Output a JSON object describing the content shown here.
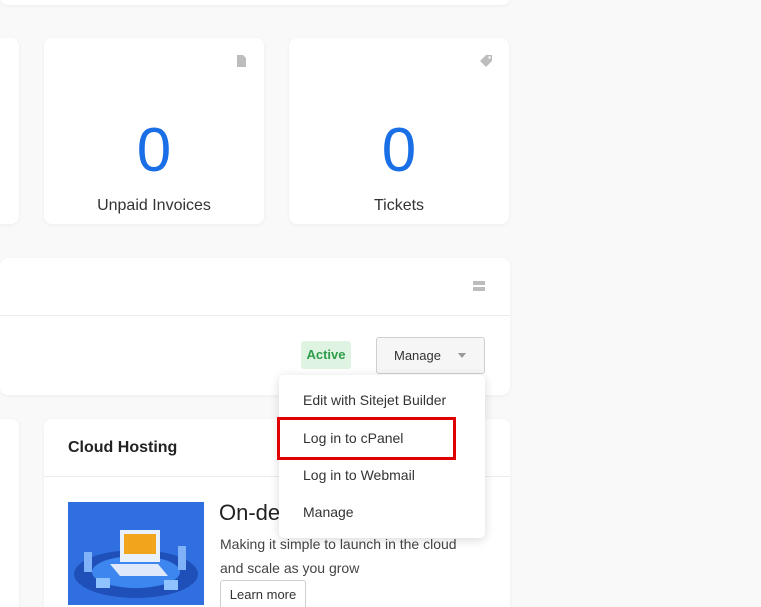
{
  "stats": {
    "invoices": {
      "value": "0",
      "label": "Unpaid Invoices",
      "icon": "document-icon"
    },
    "tickets": {
      "value": "0",
      "label": "Tickets",
      "icon": "tag-icon"
    }
  },
  "service": {
    "status": "Active",
    "manage_label": "Manage",
    "dropdown": [
      "Edit with Sitejet Builder",
      "Log in to cPanel",
      "Log in to Webmail",
      "Manage"
    ]
  },
  "cloud": {
    "title": "Cloud Hosting",
    "heading": "On-demand",
    "text": "Making it simple to launch in the cloud and scale as you grow",
    "button": "Learn more"
  },
  "colors": {
    "accent": "#1a6ee6",
    "active_bg": "#dff3e3",
    "active_text": "#2e9e4a",
    "highlight": "#e00000"
  }
}
